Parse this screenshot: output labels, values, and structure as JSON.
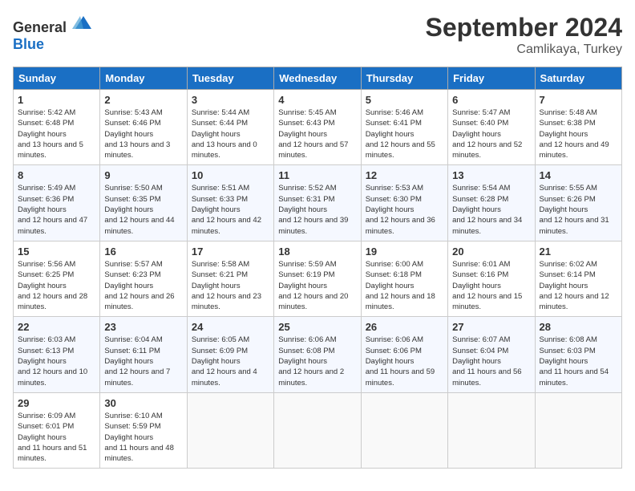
{
  "header": {
    "logo_general": "General",
    "logo_blue": "Blue",
    "month": "September 2024",
    "location": "Camlikaya, Turkey"
  },
  "weekdays": [
    "Sunday",
    "Monday",
    "Tuesday",
    "Wednesday",
    "Thursday",
    "Friday",
    "Saturday"
  ],
  "weeks": [
    [
      {
        "day": 1,
        "sunrise": "5:42 AM",
        "sunset": "6:48 PM",
        "daylight": "13 hours and 5 minutes."
      },
      {
        "day": 2,
        "sunrise": "5:43 AM",
        "sunset": "6:46 PM",
        "daylight": "13 hours and 3 minutes."
      },
      {
        "day": 3,
        "sunrise": "5:44 AM",
        "sunset": "6:44 PM",
        "daylight": "13 hours and 0 minutes."
      },
      {
        "day": 4,
        "sunrise": "5:45 AM",
        "sunset": "6:43 PM",
        "daylight": "12 hours and 57 minutes."
      },
      {
        "day": 5,
        "sunrise": "5:46 AM",
        "sunset": "6:41 PM",
        "daylight": "12 hours and 55 minutes."
      },
      {
        "day": 6,
        "sunrise": "5:47 AM",
        "sunset": "6:40 PM",
        "daylight": "12 hours and 52 minutes."
      },
      {
        "day": 7,
        "sunrise": "5:48 AM",
        "sunset": "6:38 PM",
        "daylight": "12 hours and 49 minutes."
      }
    ],
    [
      {
        "day": 8,
        "sunrise": "5:49 AM",
        "sunset": "6:36 PM",
        "daylight": "12 hours and 47 minutes."
      },
      {
        "day": 9,
        "sunrise": "5:50 AM",
        "sunset": "6:35 PM",
        "daylight": "12 hours and 44 minutes."
      },
      {
        "day": 10,
        "sunrise": "5:51 AM",
        "sunset": "6:33 PM",
        "daylight": "12 hours and 42 minutes."
      },
      {
        "day": 11,
        "sunrise": "5:52 AM",
        "sunset": "6:31 PM",
        "daylight": "12 hours and 39 minutes."
      },
      {
        "day": 12,
        "sunrise": "5:53 AM",
        "sunset": "6:30 PM",
        "daylight": "12 hours and 36 minutes."
      },
      {
        "day": 13,
        "sunrise": "5:54 AM",
        "sunset": "6:28 PM",
        "daylight": "12 hours and 34 minutes."
      },
      {
        "day": 14,
        "sunrise": "5:55 AM",
        "sunset": "6:26 PM",
        "daylight": "12 hours and 31 minutes."
      }
    ],
    [
      {
        "day": 15,
        "sunrise": "5:56 AM",
        "sunset": "6:25 PM",
        "daylight": "12 hours and 28 minutes."
      },
      {
        "day": 16,
        "sunrise": "5:57 AM",
        "sunset": "6:23 PM",
        "daylight": "12 hours and 26 minutes."
      },
      {
        "day": 17,
        "sunrise": "5:58 AM",
        "sunset": "6:21 PM",
        "daylight": "12 hours and 23 minutes."
      },
      {
        "day": 18,
        "sunrise": "5:59 AM",
        "sunset": "6:19 PM",
        "daylight": "12 hours and 20 minutes."
      },
      {
        "day": 19,
        "sunrise": "6:00 AM",
        "sunset": "6:18 PM",
        "daylight": "12 hours and 18 minutes."
      },
      {
        "day": 20,
        "sunrise": "6:01 AM",
        "sunset": "6:16 PM",
        "daylight": "12 hours and 15 minutes."
      },
      {
        "day": 21,
        "sunrise": "6:02 AM",
        "sunset": "6:14 PM",
        "daylight": "12 hours and 12 minutes."
      }
    ],
    [
      {
        "day": 22,
        "sunrise": "6:03 AM",
        "sunset": "6:13 PM",
        "daylight": "12 hours and 10 minutes."
      },
      {
        "day": 23,
        "sunrise": "6:04 AM",
        "sunset": "6:11 PM",
        "daylight": "12 hours and 7 minutes."
      },
      {
        "day": 24,
        "sunrise": "6:05 AM",
        "sunset": "6:09 PM",
        "daylight": "12 hours and 4 minutes."
      },
      {
        "day": 25,
        "sunrise": "6:06 AM",
        "sunset": "6:08 PM",
        "daylight": "12 hours and 2 minutes."
      },
      {
        "day": 26,
        "sunrise": "6:06 AM",
        "sunset": "6:06 PM",
        "daylight": "11 hours and 59 minutes."
      },
      {
        "day": 27,
        "sunrise": "6:07 AM",
        "sunset": "6:04 PM",
        "daylight": "11 hours and 56 minutes."
      },
      {
        "day": 28,
        "sunrise": "6:08 AM",
        "sunset": "6:03 PM",
        "daylight": "11 hours and 54 minutes."
      }
    ],
    [
      {
        "day": 29,
        "sunrise": "6:09 AM",
        "sunset": "6:01 PM",
        "daylight": "11 hours and 51 minutes."
      },
      {
        "day": 30,
        "sunrise": "6:10 AM",
        "sunset": "5:59 PM",
        "daylight": "11 hours and 48 minutes."
      },
      null,
      null,
      null,
      null,
      null
    ]
  ]
}
